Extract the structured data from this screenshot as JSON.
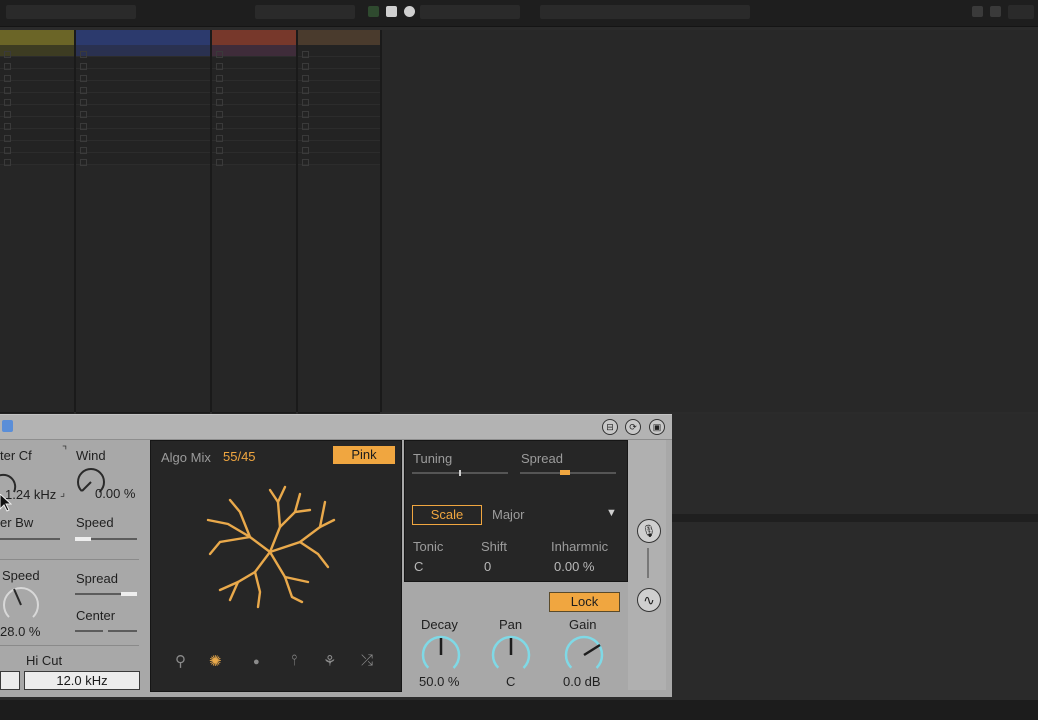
{
  "colors": {
    "accent": "#f0a640",
    "knob_arc": "#7fd9e6",
    "device_bg": "#a8a8a8",
    "panel_dark": "#262626",
    "track_colors": [
      "#6b6527",
      "#2c3a6d",
      "#77382b",
      "#4a3b2d"
    ]
  },
  "tracks": [
    {
      "header": ""
    },
    {
      "header": ""
    },
    {
      "header": ""
    },
    {
      "header": ""
    }
  ],
  "device": {
    "title_buttons": [
      "⊟",
      "⟳",
      "▣"
    ],
    "left": {
      "filter_cf_label": "ter Cf",
      "filter_cf_value": "1.24 kHz",
      "wind_label": "Wind",
      "wind_value": "0.00 %",
      "filter_bw_label": "er Bw",
      "speed_label": "Speed",
      "speed2_label": "Speed",
      "speed2_value": "28.0 %",
      "spread_label": "Spread",
      "center_label": "Center",
      "hicut_label": "Hi Cut",
      "hicut_value": "12.0 kHz"
    },
    "algo": {
      "label": "Algo Mix",
      "value": "55/45",
      "noise_button": "Pink",
      "icons": [
        "tree-icon",
        "burst-icon",
        "dot-icon",
        "pin-icon",
        "branch-icon",
        "shuffle-icon"
      ]
    },
    "tuning": {
      "tuning_label": "Tuning",
      "spread_label": "Spread",
      "scale_button": "Scale",
      "scale_value": "Major",
      "tonic_label": "Tonic",
      "tonic_value": "C",
      "shift_label": "Shift",
      "shift_value": "0",
      "inharm_label": "Inharmnic",
      "inharm_value": "0.00 %"
    },
    "output": {
      "lock_button": "Lock",
      "decay_label": "Decay",
      "decay_value": "50.0 %",
      "pan_label": "Pan",
      "pan_value": "C",
      "gain_label": "Gain",
      "gain_value": "0.0 dB"
    }
  }
}
